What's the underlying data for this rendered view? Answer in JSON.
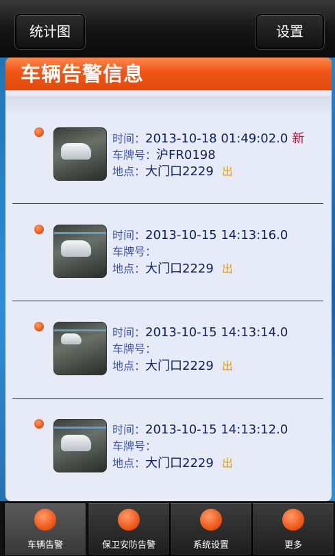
{
  "topbar": {
    "left_button": "统计图",
    "right_button": "设置"
  },
  "header": {
    "title": "车辆告警信息"
  },
  "alerts": [
    {
      "time_label": "时间：",
      "time": "2013-10-18 01:49:02.0",
      "badge": "新",
      "plate_label": "车牌号：",
      "plate": "沪FR0198",
      "location_label": "地点：",
      "location": "大门口2229",
      "direction": "出"
    },
    {
      "time_label": "时间：",
      "time": "2013-10-15 14:13:16.0",
      "badge": "",
      "plate_label": "车牌号：",
      "plate": "",
      "location_label": "地点：",
      "location": "大门口2229",
      "direction": "出"
    },
    {
      "time_label": "时间：",
      "time": "2013-10-15 14:13:14.0",
      "badge": "",
      "plate_label": "车牌号：",
      "plate": "",
      "location_label": "地点：",
      "location": "大门口2229",
      "direction": "出"
    },
    {
      "time_label": "时间：",
      "time": "2013-10-15 14:13:12.0",
      "badge": "",
      "plate_label": "车牌号：",
      "plate": "",
      "location_label": "地点：",
      "location": "大门口2229",
      "direction": "出"
    }
  ],
  "tabs": [
    {
      "label": "车辆告警",
      "icon": "orange-dot-icon",
      "active": true
    },
    {
      "label": "保卫安防告警",
      "icon": "orange-dot-icon",
      "active": false
    },
    {
      "label": "系统设置",
      "icon": "orange-dot-icon",
      "active": false
    },
    {
      "label": "更多",
      "icon": "orange-dot-icon",
      "active": false
    }
  ],
  "colors": {
    "accent": "#e9541a",
    "new_badge": "#c0102a",
    "direction": "#e59b00"
  }
}
